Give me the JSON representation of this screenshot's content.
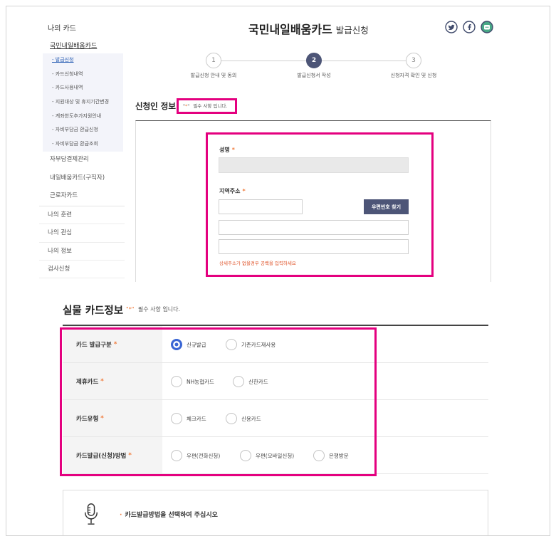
{
  "sidebar": {
    "title": "나의 카드",
    "active_menu": "국민내일배움카드",
    "submenu": [
      {
        "label": "- 발급신청",
        "active": true
      },
      {
        "label": "- 카드신청내역",
        "active": false
      },
      {
        "label": "- 카드사용내역",
        "active": false
      },
      {
        "label": "- 지원대상 및 휴지기간변경",
        "active": false
      },
      {
        "label": "- 계좌한도추가지원안내",
        "active": false
      },
      {
        "label": "- 자비부담금 환급신청",
        "active": false
      },
      {
        "label": "- 자비부담금 환급조회",
        "active": false
      }
    ],
    "menu": [
      "자부담결제관리",
      "내일배움카드(구직자)",
      "근로자카드"
    ],
    "sections": [
      "나의 훈련",
      "나의 관심",
      "나의 정보",
      "검사신청"
    ]
  },
  "header": {
    "title": "국민내일배움카드",
    "subtitle": "발급신청",
    "share_icons": [
      "twitter-icon",
      "facebook-icon",
      "blog-icon"
    ]
  },
  "steps": [
    {
      "number": "1",
      "label": "발급신청 안내 및 동의",
      "current": false
    },
    {
      "number": "2",
      "label": "발급신청서 작성",
      "current": true
    },
    {
      "number": "3",
      "label": "신청자격 확인 및 신청",
      "current": false
    }
  ],
  "required_mark": "*",
  "required_note": {
    "quote_open": "\"",
    "mark": "*",
    "quote_close": "\"",
    "text": "필수 사항 입니다."
  },
  "applicant": {
    "heading": "신청인 정보",
    "name_label": "성명",
    "name_value": "",
    "address_label": "지역주소",
    "zipcode_value": "",
    "address1_value": "",
    "address2_value": "",
    "zipcode_button": "우편번호 찾기",
    "address_hint": "상세주소가 없을경우 공백을 입력하세요"
  },
  "card_info": {
    "heading": "실물 카드정보",
    "rows": [
      {
        "label": "카드 발급구분",
        "options": [
          {
            "label": "신규발급",
            "selected": true
          },
          {
            "label": "기존카드재사용",
            "selected": false
          }
        ]
      },
      {
        "label": "제휴카드",
        "options": [
          {
            "label": "NH농협카드",
            "selected": false
          },
          {
            "label": "신한카드",
            "selected": false
          }
        ]
      },
      {
        "label": "카드유형",
        "options": [
          {
            "label": "체크카드",
            "selected": false
          },
          {
            "label": "신용카드",
            "selected": false
          }
        ]
      },
      {
        "label": "카드발급(신청)방법",
        "options": [
          {
            "label": "우편(전화신청)",
            "selected": false
          },
          {
            "label": "우편(모바일신청)",
            "selected": false
          },
          {
            "label": "은행방문",
            "selected": false
          }
        ]
      }
    ]
  },
  "notice": {
    "icon": "microphone-icon",
    "bullet": "·",
    "text": "카드발급방법을 선택하여 주십시오"
  },
  "colors": {
    "accent_navy": "#4d5577",
    "highlight_magenta": "#e4007f",
    "required_orange": "#f07a3a",
    "radio_selected": "#3a66d4",
    "hint_red": "#e0552b",
    "active_link": "#2b5fb4"
  }
}
